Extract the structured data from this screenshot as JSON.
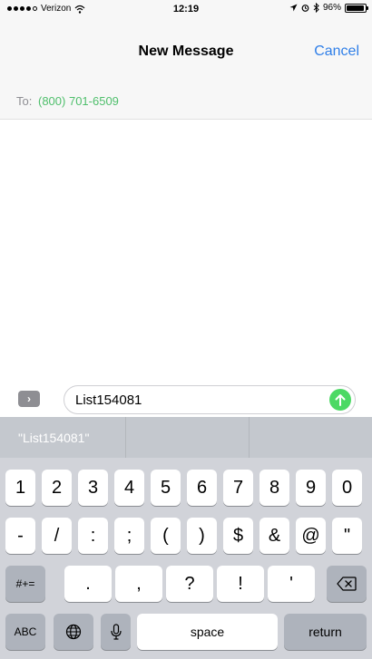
{
  "status": {
    "carrier": "Verizon",
    "time": "12:19",
    "battery": "96%",
    "battery_level": 0.96
  },
  "nav": {
    "title": "New Message",
    "cancel": "Cancel"
  },
  "to": {
    "label": "To:",
    "value": "(800) 701-6509"
  },
  "compose": {
    "text": "List154081",
    "expand_glyph": "›"
  },
  "predictive": {
    "suggestions": [
      "\"List154081\"",
      "",
      ""
    ]
  },
  "keyboard": {
    "row1": [
      "1",
      "2",
      "3",
      "4",
      "5",
      "6",
      "7",
      "8",
      "9",
      "0"
    ],
    "row2": [
      "-",
      "/",
      ":",
      ";",
      "(",
      ")",
      "$",
      "&",
      "@",
      "\""
    ],
    "row3": {
      "shift": "#+=",
      "keys": [
        ".",
        ",",
        "?",
        "!",
        "'"
      ]
    },
    "row4": {
      "abc": "ABC",
      "space": "space",
      "return": "return"
    }
  },
  "colors": {
    "accent": "#2f7fe8",
    "recipient": "#4fbf6c",
    "send": "#4cd964"
  },
  "icons": [
    "wifi-icon",
    "location-icon",
    "alarm-icon",
    "bluetooth-icon",
    "battery-icon",
    "send-arrow-icon",
    "globe-icon",
    "microphone-icon",
    "delete-icon"
  ]
}
